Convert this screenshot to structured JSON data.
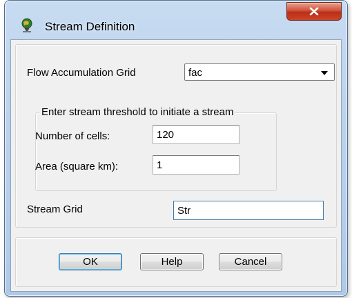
{
  "window": {
    "title": "Stream Definition",
    "close_icon": "close-x-icon",
    "app_icon": "globe-pin-icon"
  },
  "form": {
    "flow_accumulation_label": "Flow Accumulation Grid",
    "flow_accumulation_value": "fac",
    "threshold_group_label": "Enter stream threshold to initiate a stream",
    "cells_label": "Number of cells:",
    "cells_value": "120",
    "area_label": "Area (square km):",
    "area_value": "1",
    "stream_grid_label": "Stream Grid",
    "stream_grid_value": "Str"
  },
  "buttons": {
    "ok": "OK",
    "help": "Help",
    "cancel": "Cancel"
  },
  "colors": {
    "frame": "#bcd3ed",
    "close_button": "#c9452a",
    "dialog_background": "#f0f0f0"
  }
}
